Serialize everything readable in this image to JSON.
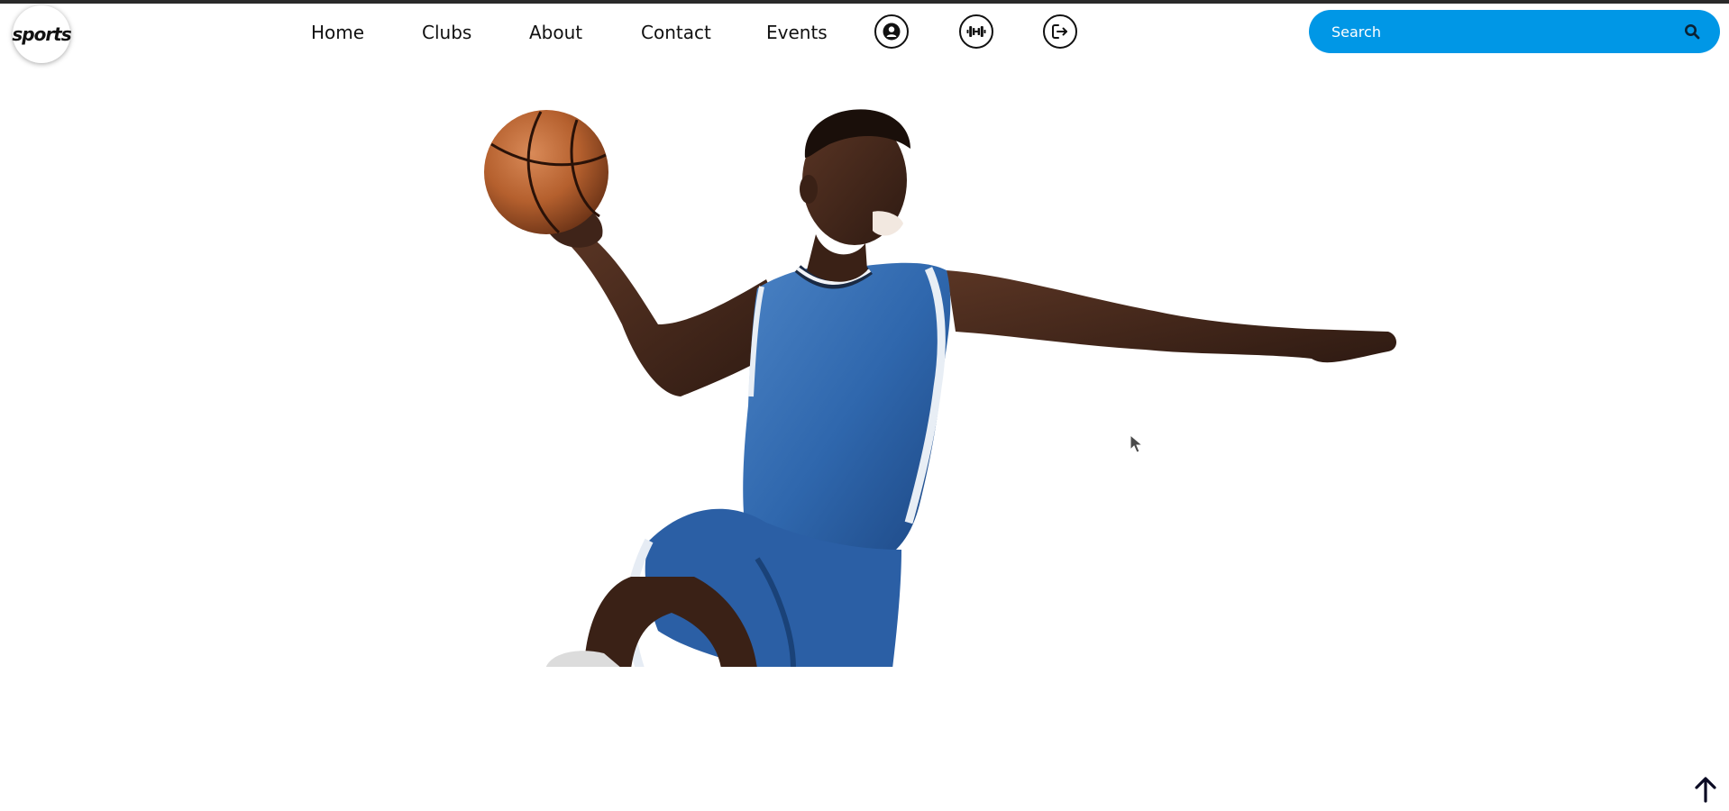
{
  "logo": {
    "text": "sports"
  },
  "nav": {
    "items": [
      {
        "label": "Home"
      },
      {
        "label": "Clubs"
      },
      {
        "label": "About"
      },
      {
        "label": "Contact"
      },
      {
        "label": "Events"
      }
    ]
  },
  "header_icons": [
    "user-icon",
    "dumbbell-icon",
    "logout-icon"
  ],
  "search": {
    "placeholder": "Search",
    "value": ""
  },
  "colors": {
    "search_bg": "#0097e6",
    "top_border": "#2a2a2a",
    "jersey_blue": "#2f67ad",
    "ball_orange": "#b5602e"
  },
  "hero": {
    "subject": "basketball-player-image"
  },
  "scroll_top": {
    "icon": "arrow-up-icon"
  }
}
